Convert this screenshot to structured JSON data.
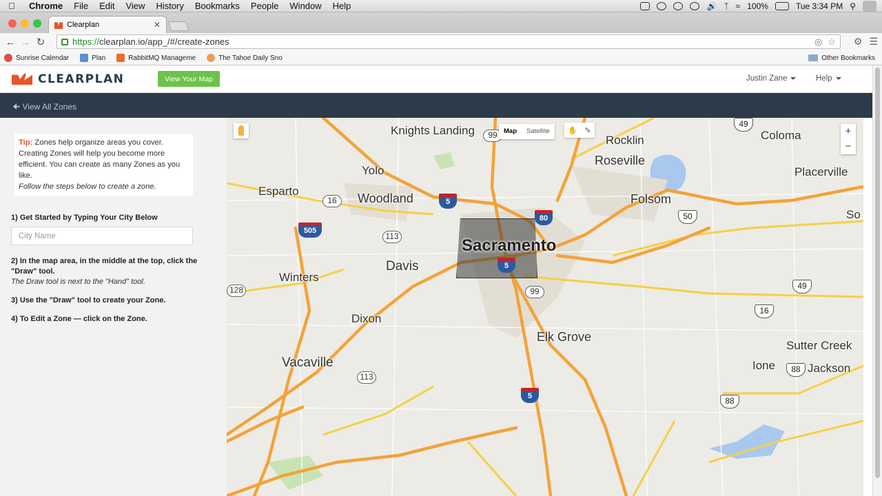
{
  "os_menu": {
    "app": "Chrome",
    "items": [
      "File",
      "Edit",
      "View",
      "History",
      "Bookmarks",
      "People",
      "Window",
      "Help"
    ],
    "battery": "100%",
    "clock": "Tue 3:34 PM"
  },
  "browser": {
    "tab_title": "Clearplan",
    "url_scheme": "https://",
    "url_rest": "clearplan.io/app_/#/create-zones",
    "bookmarks": [
      {
        "label": "Sunrise Calendar",
        "color": "#e34b4b"
      },
      {
        "label": "Plan",
        "color": "#5b8fd6"
      },
      {
        "label": "RabbitMQ Manageme",
        "color": "#f06a28"
      },
      {
        "label": "The Tahoe Daily Sno",
        "color": "#e8a05a"
      }
    ],
    "other_bookmarks": "Other Bookmarks"
  },
  "app": {
    "logo": "CLEARPLAN",
    "view_map_button": "View Your Map",
    "user": "Justin Zane",
    "help": "Help",
    "back_link": "View All Zones"
  },
  "sidebar": {
    "tip_label": "Tip:",
    "tip_text": " Zones help organize areas you cover. Creating Zones will help you become more efficient. You can create as many Zones as you like.",
    "tip_italic": "Follow the steps below to create a zone.",
    "step1": "1) Get Started by Typing Your City Below",
    "city_placeholder": "City Name",
    "step2": "2) In the map area, in the middle at the top, click the \"Draw\" tool.",
    "step2_note": "The Draw tool is next to the \"Hand\" tool.",
    "step3": "3) Use the \"Draw\" tool to create your Zone.",
    "step4": "4) To Edit a Zone — click on the Zone."
  },
  "map": {
    "type_map": "Map",
    "type_satellite": "Satellite",
    "zoom_in": "+",
    "zoom_out": "−",
    "cities": [
      "Knights Landing",
      "Yolo",
      "Esparto",
      "Woodland",
      "Davis",
      "Winters",
      "Dixon",
      "Vacaville",
      "Sacramento",
      "Elk Grove",
      "Rocklin",
      "Roseville",
      "Folsom",
      "Coloma",
      "Placerville",
      "Sutter Creek",
      "Ione",
      "Jackson",
      "So"
    ],
    "routes": [
      "99",
      "16",
      "505",
      "113",
      "5",
      "80",
      "128",
      "99",
      "113",
      "5",
      "49",
      "50",
      "49",
      "16",
      "88",
      "88",
      "5"
    ]
  },
  "colors": {
    "accent": "#e8532c",
    "green_button": "#6cc24a",
    "nav_bar": "#2c3a4a",
    "highway": "#f2a33a",
    "major_road": "#f6cf47"
  }
}
